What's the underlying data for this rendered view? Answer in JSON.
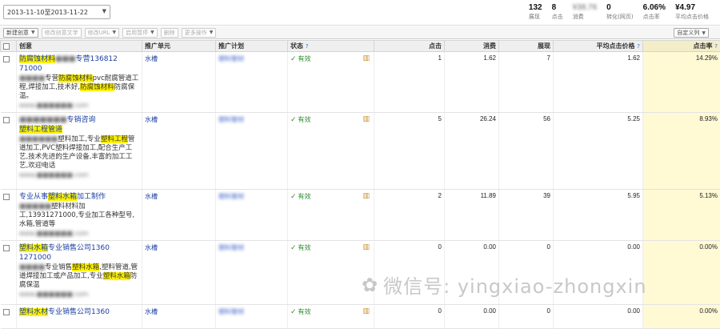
{
  "date_range": {
    "value": "2013-11-10至2013-11-22",
    "arrow": "▼"
  },
  "stats": [
    {
      "value": "132",
      "label": "展现",
      "blur": false
    },
    {
      "value": "8",
      "label": "点击",
      "blur": false
    },
    {
      "value": "¥38.76",
      "label": "消费",
      "blur": true
    },
    {
      "value": "0",
      "label": "转化(网页)",
      "blur": false
    },
    {
      "value": "6.06%",
      "label": "点击率",
      "blur": false
    },
    {
      "value": "¥4.97",
      "label": "平均点击价格",
      "blur": false
    }
  ],
  "toolbar": {
    "new_creative": "新建创意",
    "edit_text": "修改创意文字",
    "edit_url": "修改URL",
    "enable": "启用暂停",
    "delete": "删除",
    "more": "更多操作",
    "custom_columns": "自定义列"
  },
  "columns": {
    "creative": "创意",
    "unit": "推广单元",
    "plan": "推广计划",
    "status": "状态",
    "clicks": "点击",
    "cost": "消费",
    "impressions": "展现",
    "avg_cpc": "平均点击价格",
    "ctr": "点击率"
  },
  "rows": [
    {
      "title_parts": [
        {
          "t": "防腐蚀材料",
          "hl": true
        },
        {
          "t": "■■■",
          "blur": true
        },
        {
          "t": "专营136812"
        }
      ],
      "title2": "71000",
      "body_parts": [
        {
          "t": "■■■■",
          "blur": true
        },
        {
          "t": "专营"
        },
        {
          "t": "防腐蚀材料",
          "hl": true
        },
        {
          "t": "pvc耐腐管道工程,焊接加工,技术好,"
        },
        {
          "t": "防腐蚀材料",
          "hl": true
        },
        {
          "t": "防腐保温。"
        }
      ],
      "url": "www.■■■■■■.com",
      "unit": "水槽",
      "plan": "塑料管材",
      "status": "有效",
      "clicks": "1",
      "cost": "1.62",
      "impressions": "7",
      "avg_cpc": "1.62",
      "ctr": "14.29%"
    },
    {
      "title_parts": [
        {
          "t": "■■■■■■■",
          "blur": true
        },
        {
          "t": "专销咨询"
        }
      ],
      "title2": "塑料工程管道",
      "title2_hl": true,
      "body_parts": [
        {
          "t": "■■■■■■",
          "blur": true
        },
        {
          "t": "塑料加工,专业"
        },
        {
          "t": "塑料工程",
          "hl": true
        },
        {
          "t": "管道加工,PVC塑料焊接加工,配合生产工艺,技术先进的生产设备,丰富的加工工艺,欢迎电话"
        }
      ],
      "url": "www.■■■■■■.com",
      "unit": "水槽",
      "plan": "塑料管材",
      "status": "有效",
      "clicks": "5",
      "cost": "26.24",
      "impressions": "56",
      "avg_cpc": "5.25",
      "ctr": "8.93%"
    },
    {
      "title_parts": [
        {
          "t": "专业从事"
        },
        {
          "t": "塑料水箱",
          "hl": true
        },
        {
          "t": "加工制作"
        }
      ],
      "title2": "",
      "body_parts": [
        {
          "t": "■■■■■",
          "blur": true
        },
        {
          "t": "塑料材料加工,13931271000,专业加工各种型号,水箱,管道等"
        }
      ],
      "url": "www.■■■■■■.com",
      "unit": "水槽",
      "plan": "塑料管材",
      "status": "有效",
      "clicks": "2",
      "cost": "11.89",
      "impressions": "39",
      "avg_cpc": "5.95",
      "ctr": "5.13%"
    },
    {
      "title_parts": [
        {
          "t": "塑料水箱",
          "hl": true
        },
        {
          "t": "专业销售公司1360"
        }
      ],
      "title2": "1271000",
      "body_parts": [
        {
          "t": "■■■■",
          "blur": true
        },
        {
          "t": "专业销售"
        },
        {
          "t": "塑料水箱",
          "hl": true
        },
        {
          "t": ",塑料管道,管道焊接加工或产品加工,专业"
        },
        {
          "t": "塑料水箱",
          "hl": true
        },
        {
          "t": "防腐保温"
        }
      ],
      "url": "www.■■■■■■.com",
      "unit": "水槽",
      "plan": "塑料管材",
      "status": "有效",
      "clicks": "0",
      "cost": "0.00",
      "impressions": "0",
      "avg_cpc": "0.00",
      "ctr": "0.00%"
    },
    {
      "title_parts": [
        {
          "t": "塑料水材",
          "hl": true
        },
        {
          "t": "专业销售公司1360"
        }
      ],
      "title2": "",
      "body_parts": [],
      "url": "",
      "unit": "水槽",
      "plan": "塑料管材",
      "status": "有效",
      "clicks": "0",
      "cost": "0.00",
      "impressions": "0",
      "avg_cpc": "0.00",
      "ctr": "0.00%"
    }
  ],
  "watermark": "微信号: yingxiao-zhongxin"
}
